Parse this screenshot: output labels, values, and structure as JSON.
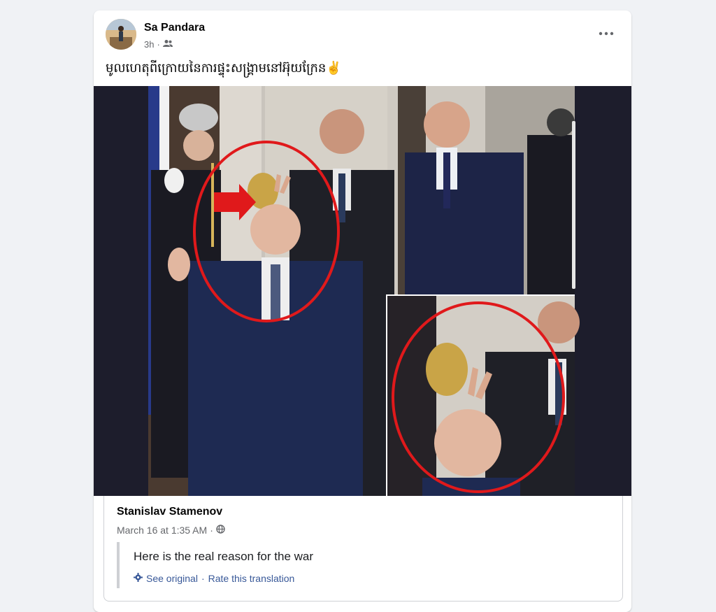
{
  "post": {
    "author": "Sa Pandara",
    "time": "3h",
    "separator": "·",
    "caption": "មូលហេតុពីក្រោយនៃការផ្ទុះសង្គ្រាមនៅអ៊ុយក្រែន",
    "caption_emoji": "✌"
  },
  "shared": {
    "author": "Stanislav Stamenov",
    "date": "March 16 at 1:35 AM",
    "separator": "·",
    "text": "Here is the real reason for the war",
    "see_original": "See original",
    "dot": "·",
    "rate": "Rate this translation"
  },
  "icons": {
    "audience": "friends-icon",
    "globe": "globe-icon",
    "gear": "gear-icon",
    "more": "more-options-icon"
  },
  "colors": {
    "page_bg": "#f0f2f5",
    "link": "#385898",
    "secondary_text": "#65676b",
    "annotation_red": "#e0191b"
  }
}
